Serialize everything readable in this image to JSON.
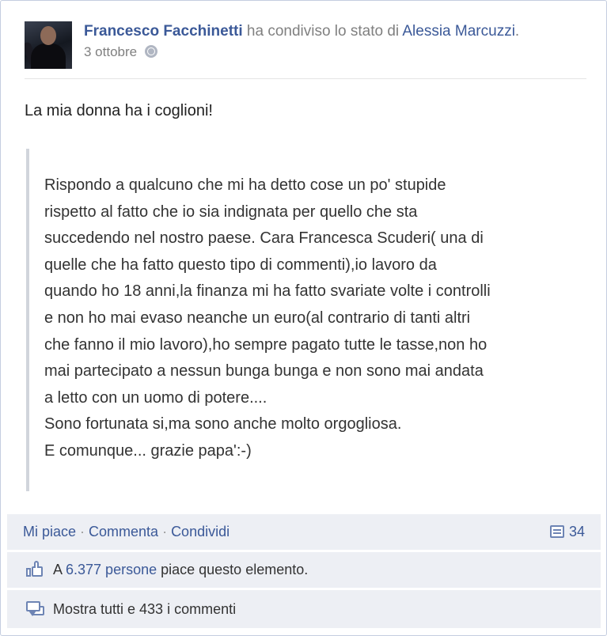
{
  "post": {
    "author": "Francesco Facchinetti",
    "action_prefix": " ha condiviso lo stato di ",
    "shared_from": "Alessia Marcuzzi",
    "action_suffix": ".",
    "date": "3 ottobre",
    "privacy_icon": "globe-icon",
    "status": "La mia donna ha i coglioni!",
    "quoted_text": "Rispondo a qualcuno che mi ha detto cose un po' stupide\nrispetto al fatto che io sia indignata per quello che sta\nsuccedendo nel nostro paese. Cara Francesca Scuderi( una di\nquelle che ha fatto questo tipo di commenti),io lavoro da\nquando ho 18 anni,la finanza mi ha fatto svariate volte i controlli\ne non ho mai evaso neanche un euro(al contrario di tanti altri\nche fanno il mio lavoro),ho sempre pagato tutte le tasse,non ho\nmai partecipato a nessun bunga bunga e non sono mai andata\na letto con un uomo di potere....\nSono fortunata si,ma sono anche molto orgogliosa.\nE comunque... grazie papa':-)"
  },
  "actions": {
    "like": "Mi piace",
    "separator": "·",
    "comment": "Commenta",
    "share": "Condividi",
    "share_count": "34"
  },
  "likes": {
    "prefix": "A ",
    "count_text": "6.377 persone",
    "suffix": " piace questo elemento."
  },
  "comments": {
    "view_all": "Mostra tutti e 433 i commenti"
  },
  "colors": {
    "link": "#3b5998",
    "bar_bg": "#edeff4"
  }
}
